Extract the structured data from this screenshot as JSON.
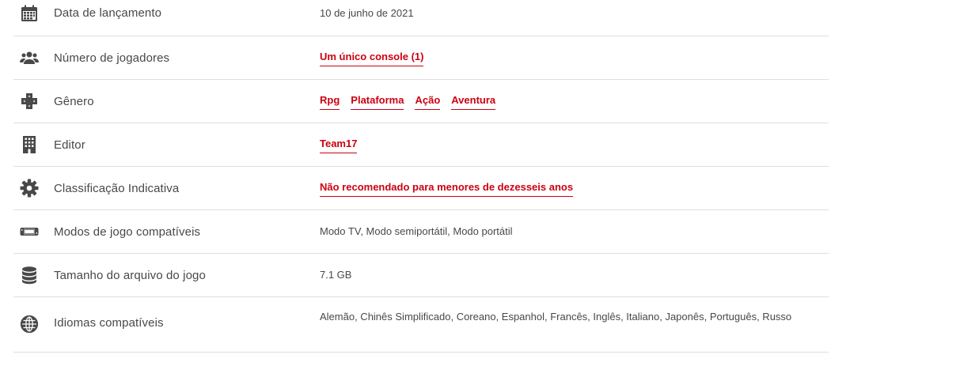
{
  "colors": {
    "accent": "#cc0011",
    "text": "#484848",
    "divider": "#dedede"
  },
  "rows": {
    "release": {
      "icon": "calendar-icon",
      "label": "Data de lançamento",
      "value": "10 de junho de 2021"
    },
    "players": {
      "icon": "users-icon",
      "label": "Número de jogadores",
      "links": [
        "Um único console (1)"
      ]
    },
    "genre": {
      "icon": "dpad-icon",
      "label": "Gênero",
      "links": [
        "Rpg",
        "Plataforma",
        "Ação",
        "Aventura"
      ]
    },
    "publisher": {
      "icon": "building-icon",
      "label": "Editor",
      "links": [
        "Team17"
      ]
    },
    "rating": {
      "icon": "gear-icon",
      "label": "Classificação Indicativa",
      "links": [
        "Não recomendado para menores de dezesseis anos"
      ]
    },
    "modes": {
      "icon": "switch-console-icon",
      "label": "Modos de jogo compatíveis",
      "value": "Modo TV, Modo semiportátil, Modo portátil"
    },
    "size": {
      "icon": "database-icon",
      "label": "Tamanho do arquivo do jogo",
      "value": "7.1 GB"
    },
    "languages": {
      "icon": "globe-icon",
      "label": "Idiomas compatíveis",
      "value": "Alemão, Chinês Simplificado, Coreano, Espanhol, Francês, Inglês, Italiano, Japonês, Português, Russo"
    }
  }
}
